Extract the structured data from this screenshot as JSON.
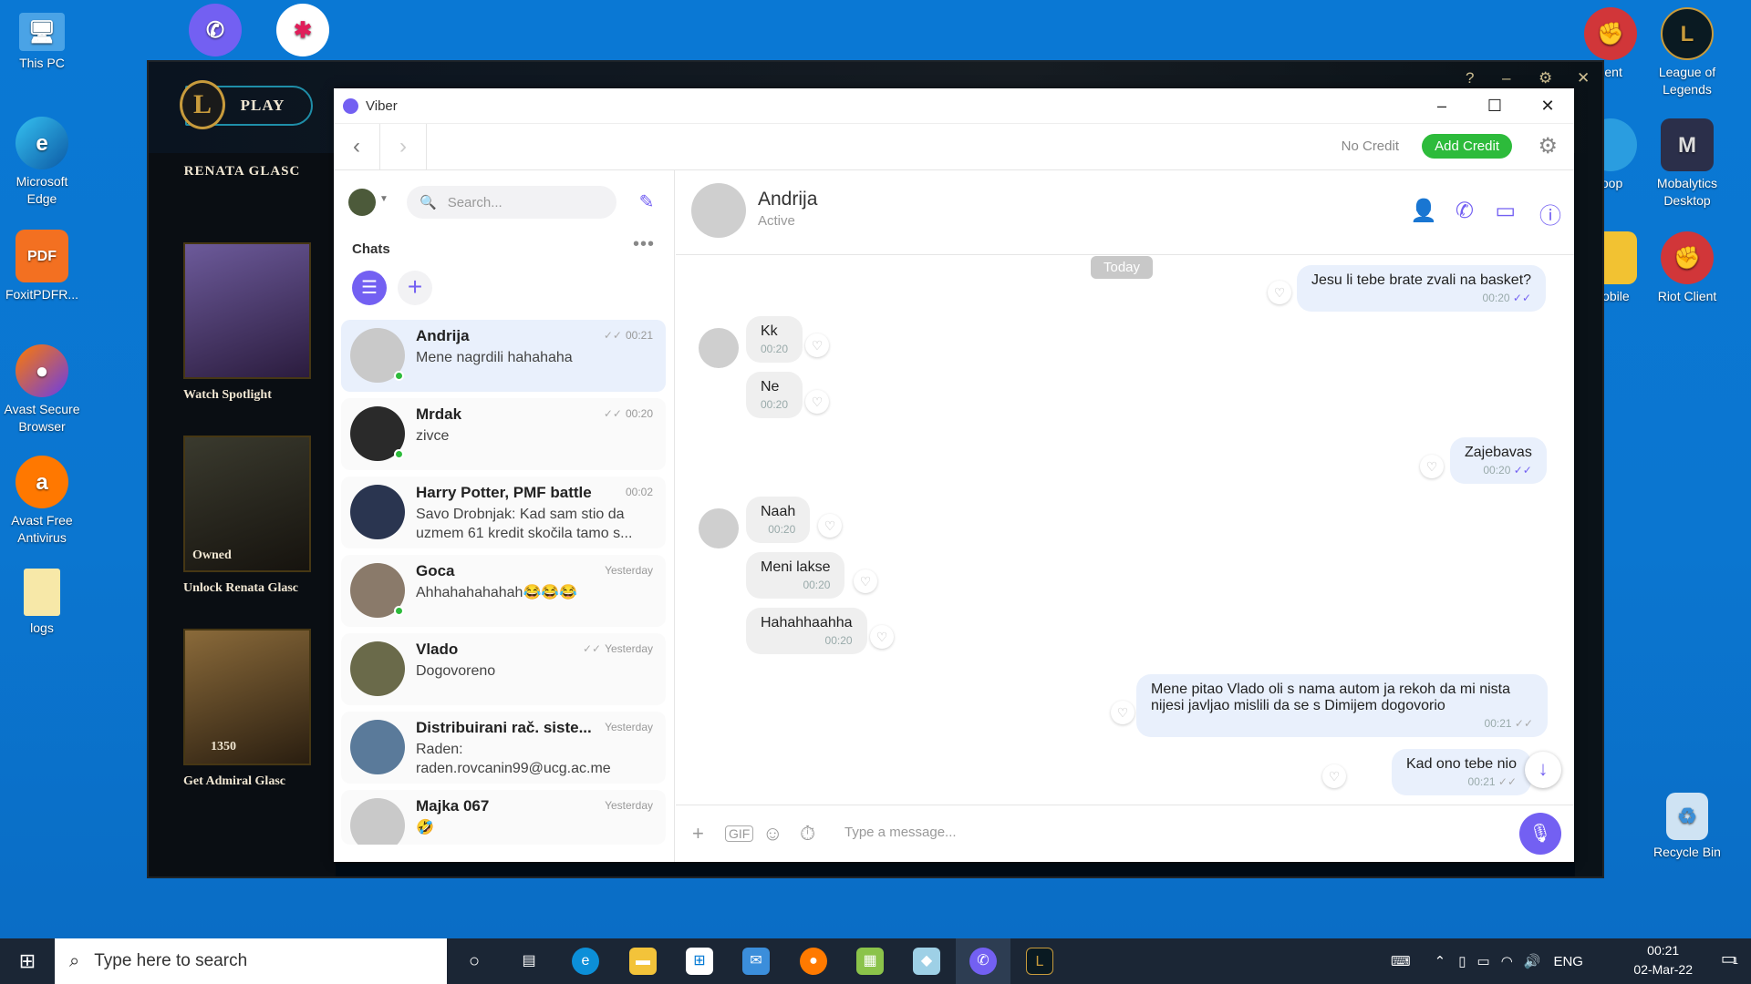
{
  "desktop": {
    "icons_left": [
      {
        "label": "This PC",
        "icon": "computer-icon"
      },
      {
        "label": "Microsoft Edge",
        "icon": "edge-icon"
      },
      {
        "label": "FoxitPDFR...",
        "icon": "foxit-pdf-icon"
      },
      {
        "label": "Avast Secure Browser",
        "icon": "avast-browser-icon"
      },
      {
        "label": "Avast Free Antivirus",
        "icon": "avast-antivirus-icon"
      },
      {
        "label": "logs",
        "icon": "folder-icon"
      }
    ],
    "icons_right": [
      {
        "label": "lient",
        "icon": "riot-client-icon"
      },
      {
        "label": "League of Legends",
        "icon": "league-icon"
      },
      {
        "label": "loop",
        "icon": "app-icon"
      },
      {
        "label": "Mobalytics Desktop",
        "icon": "mobalytics-icon"
      },
      {
        "label": "Mobile",
        "icon": "app-icon"
      },
      {
        "label": "Riot Client",
        "icon": "riot-client-icon"
      },
      {
        "label": "Recycle Bin",
        "icon": "recycle-bin-icon"
      }
    ]
  },
  "lol": {
    "play": "PLAY",
    "champion": "RENATA GLASC",
    "skins": [
      {
        "label": "Watch Spotlight",
        "badge": ""
      },
      {
        "label": "Unlock Renata Glasc",
        "badge": "Owned"
      },
      {
        "label": "Get Admiral Glasc",
        "badge": "1350"
      }
    ],
    "controls": [
      "?",
      "–",
      "⚙",
      "✕"
    ]
  },
  "viber": {
    "title": "Viber",
    "no_credit": "No Credit",
    "add_credit": "Add Credit",
    "search_placeholder": "Search...",
    "chats_heading": "Chats",
    "chats": [
      {
        "name": "Andrija",
        "preview": "Mene nagrdili hahahaha",
        "time": "00:21",
        "read": true,
        "online": true,
        "active": true
      },
      {
        "name": "Mrdak",
        "preview": "zivce",
        "time": "00:20",
        "read": true,
        "online": true,
        "active": false
      },
      {
        "name": "Harry Potter, PMF battle",
        "preview": "Savo Drobnjak: Kad sam stio da uzmem 61 kredit skočila tamo s...",
        "time": "00:02",
        "read": false,
        "online": false,
        "active": false
      },
      {
        "name": "Goca",
        "preview": "Ahhahahahahah😂😂😂",
        "time": "Yesterday",
        "read": false,
        "online": true,
        "active": false
      },
      {
        "name": "Vlado",
        "preview": "Dogovoreno",
        "time": "Yesterday",
        "read": true,
        "online": false,
        "active": false
      },
      {
        "name": "Distribuirani rač. siste...",
        "preview": "Raden: raden.rovcanin99@ucg.ac.me",
        "time": "Yesterday",
        "read": false,
        "online": false,
        "active": false
      },
      {
        "name": "Majka 067",
        "preview": "🤣",
        "time": "Yesterday",
        "read": false,
        "online": false,
        "active": false
      }
    ],
    "conversation": {
      "name": "Andrija",
      "status": "Active",
      "date_divider": "Today",
      "messages": [
        {
          "dir": "out",
          "text": "Jesu li tebe brate zvali na basket?",
          "time": "00:20"
        },
        {
          "dir": "in",
          "text": "Kk",
          "time": "00:20"
        },
        {
          "dir": "in",
          "text": "Ne",
          "time": "00:20"
        },
        {
          "dir": "out",
          "text": "Zajebavas",
          "time": "00:20"
        },
        {
          "dir": "in",
          "text": "Naah",
          "time": "00:20"
        },
        {
          "dir": "in",
          "text": "Meni lakse",
          "time": "00:20"
        },
        {
          "dir": "in",
          "text": "Hahahhaahha",
          "time": "00:20"
        },
        {
          "dir": "out",
          "text": "Mene pitao Vlado oli s nama autom ja rekoh da mi nista nijesi javljao mislili da se s Dimijem dogovorio",
          "time": "00:21"
        },
        {
          "dir": "out",
          "text": "Kad ono tebe nio",
          "time": "00:21"
        }
      ]
    },
    "composer_placeholder": "Type a message..."
  },
  "taskbar": {
    "search_placeholder": "Type here to search",
    "language": "ENG",
    "time": "00:21",
    "date": "02-Mar-22",
    "notification_count": "1"
  }
}
